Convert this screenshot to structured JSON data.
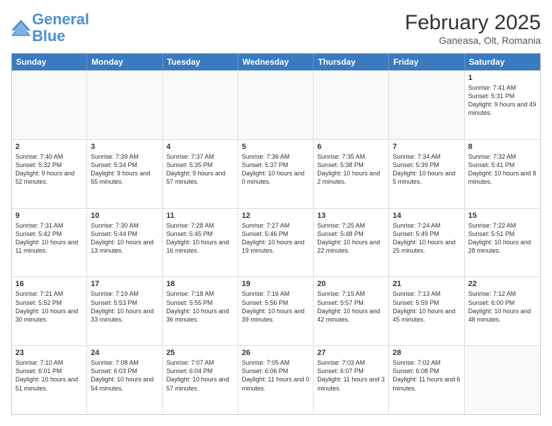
{
  "logo": {
    "line1": "General",
    "line2": "Blue"
  },
  "title": "February 2025",
  "location": "Ganeasa, Olt, Romania",
  "days_of_week": [
    "Sunday",
    "Monday",
    "Tuesday",
    "Wednesday",
    "Thursday",
    "Friday",
    "Saturday"
  ],
  "weeks": [
    [
      {
        "day": "",
        "text": ""
      },
      {
        "day": "",
        "text": ""
      },
      {
        "day": "",
        "text": ""
      },
      {
        "day": "",
        "text": ""
      },
      {
        "day": "",
        "text": ""
      },
      {
        "day": "",
        "text": ""
      },
      {
        "day": "1",
        "text": "Sunrise: 7:41 AM\nSunset: 5:31 PM\nDaylight: 9 hours and 49 minutes."
      }
    ],
    [
      {
        "day": "2",
        "text": "Sunrise: 7:40 AM\nSunset: 5:32 PM\nDaylight: 9 hours and 52 minutes."
      },
      {
        "day": "3",
        "text": "Sunrise: 7:39 AM\nSunset: 5:34 PM\nDaylight: 9 hours and 55 minutes."
      },
      {
        "day": "4",
        "text": "Sunrise: 7:37 AM\nSunset: 5:35 PM\nDaylight: 9 hours and 57 minutes."
      },
      {
        "day": "5",
        "text": "Sunrise: 7:36 AM\nSunset: 5:37 PM\nDaylight: 10 hours and 0 minutes."
      },
      {
        "day": "6",
        "text": "Sunrise: 7:35 AM\nSunset: 5:38 PM\nDaylight: 10 hours and 2 minutes."
      },
      {
        "day": "7",
        "text": "Sunrise: 7:34 AM\nSunset: 5:39 PM\nDaylight: 10 hours and 5 minutes."
      },
      {
        "day": "8",
        "text": "Sunrise: 7:32 AM\nSunset: 5:41 PM\nDaylight: 10 hours and 8 minutes."
      }
    ],
    [
      {
        "day": "9",
        "text": "Sunrise: 7:31 AM\nSunset: 5:42 PM\nDaylight: 10 hours and 11 minutes."
      },
      {
        "day": "10",
        "text": "Sunrise: 7:30 AM\nSunset: 5:44 PM\nDaylight: 10 hours and 13 minutes."
      },
      {
        "day": "11",
        "text": "Sunrise: 7:28 AM\nSunset: 5:45 PM\nDaylight: 10 hours and 16 minutes."
      },
      {
        "day": "12",
        "text": "Sunrise: 7:27 AM\nSunset: 5:46 PM\nDaylight: 10 hours and 19 minutes."
      },
      {
        "day": "13",
        "text": "Sunrise: 7:25 AM\nSunset: 5:48 PM\nDaylight: 10 hours and 22 minutes."
      },
      {
        "day": "14",
        "text": "Sunrise: 7:24 AM\nSunset: 5:49 PM\nDaylight: 10 hours and 25 minutes."
      },
      {
        "day": "15",
        "text": "Sunrise: 7:22 AM\nSunset: 5:51 PM\nDaylight: 10 hours and 28 minutes."
      }
    ],
    [
      {
        "day": "16",
        "text": "Sunrise: 7:21 AM\nSunset: 5:52 PM\nDaylight: 10 hours and 30 minutes."
      },
      {
        "day": "17",
        "text": "Sunrise: 7:19 AM\nSunset: 5:53 PM\nDaylight: 10 hours and 33 minutes."
      },
      {
        "day": "18",
        "text": "Sunrise: 7:18 AM\nSunset: 5:55 PM\nDaylight: 10 hours and 36 minutes."
      },
      {
        "day": "19",
        "text": "Sunrise: 7:16 AM\nSunset: 5:56 PM\nDaylight: 10 hours and 39 minutes."
      },
      {
        "day": "20",
        "text": "Sunrise: 7:15 AM\nSunset: 5:57 PM\nDaylight: 10 hours and 42 minutes."
      },
      {
        "day": "21",
        "text": "Sunrise: 7:13 AM\nSunset: 5:59 PM\nDaylight: 10 hours and 45 minutes."
      },
      {
        "day": "22",
        "text": "Sunrise: 7:12 AM\nSunset: 6:00 PM\nDaylight: 10 hours and 48 minutes."
      }
    ],
    [
      {
        "day": "23",
        "text": "Sunrise: 7:10 AM\nSunset: 6:01 PM\nDaylight: 10 hours and 51 minutes."
      },
      {
        "day": "24",
        "text": "Sunrise: 7:08 AM\nSunset: 6:03 PM\nDaylight: 10 hours and 54 minutes."
      },
      {
        "day": "25",
        "text": "Sunrise: 7:07 AM\nSunset: 6:04 PM\nDaylight: 10 hours and 57 minutes."
      },
      {
        "day": "26",
        "text": "Sunrise: 7:05 AM\nSunset: 6:06 PM\nDaylight: 11 hours and 0 minutes."
      },
      {
        "day": "27",
        "text": "Sunrise: 7:03 AM\nSunset: 6:07 PM\nDaylight: 11 hours and 3 minutes."
      },
      {
        "day": "28",
        "text": "Sunrise: 7:02 AM\nSunset: 6:08 PM\nDaylight: 11 hours and 6 minutes."
      },
      {
        "day": "",
        "text": ""
      }
    ]
  ]
}
